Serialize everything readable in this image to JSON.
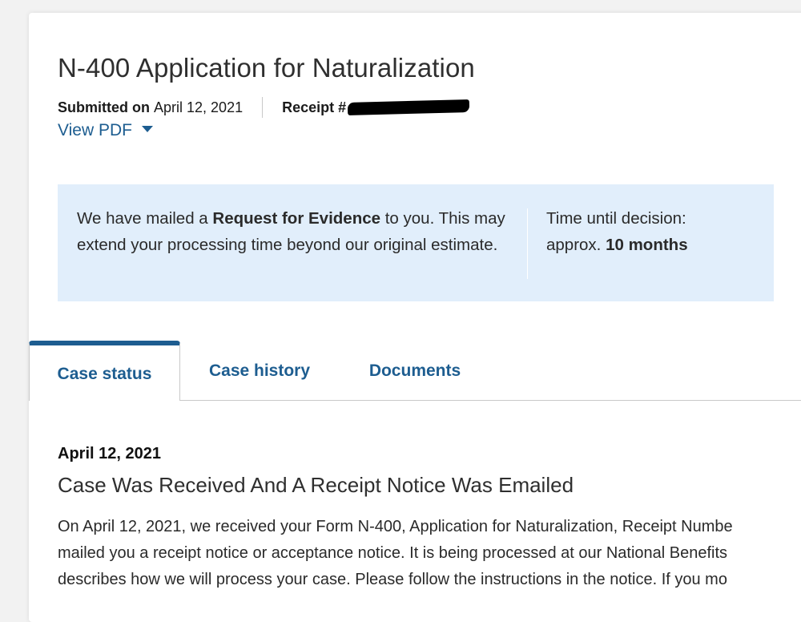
{
  "application": {
    "title": "N-400 Application for Naturalization",
    "submitted_label": "Submitted on",
    "submitted_date": "April 12, 2021",
    "receipt_label": "Receipt #",
    "view_pdf_label": "View PDF"
  },
  "notice": {
    "text_prefix": "We have mailed a ",
    "text_bold": "Request for Evidence",
    "text_suffix": " to you. This may extend your processing time beyond our original estimate.",
    "time_label": "Time until decision:",
    "time_prefix": "approx. ",
    "time_value": "10 months"
  },
  "tabs": [
    {
      "label": "Case status"
    },
    {
      "label": "Case history"
    },
    {
      "label": "Documents"
    }
  ],
  "case_status": {
    "date": "April 12, 2021",
    "title": "Case Was Received And A Receipt Notice Was Emailed",
    "lines": [
      "On April 12, 2021, we received your Form N-400, Application for Naturalization, Receipt Numbe",
      "mailed you a receipt notice or acceptance notice. It is being processed at our National Benefits",
      "describes how we will process your case. Please follow the instructions in the notice. If you mo"
    ]
  },
  "colors": {
    "accent": "#1d5d90",
    "notice_bg": "#e1eefb"
  },
  "icons": {
    "view_pdf": "caret-down-icon"
  }
}
